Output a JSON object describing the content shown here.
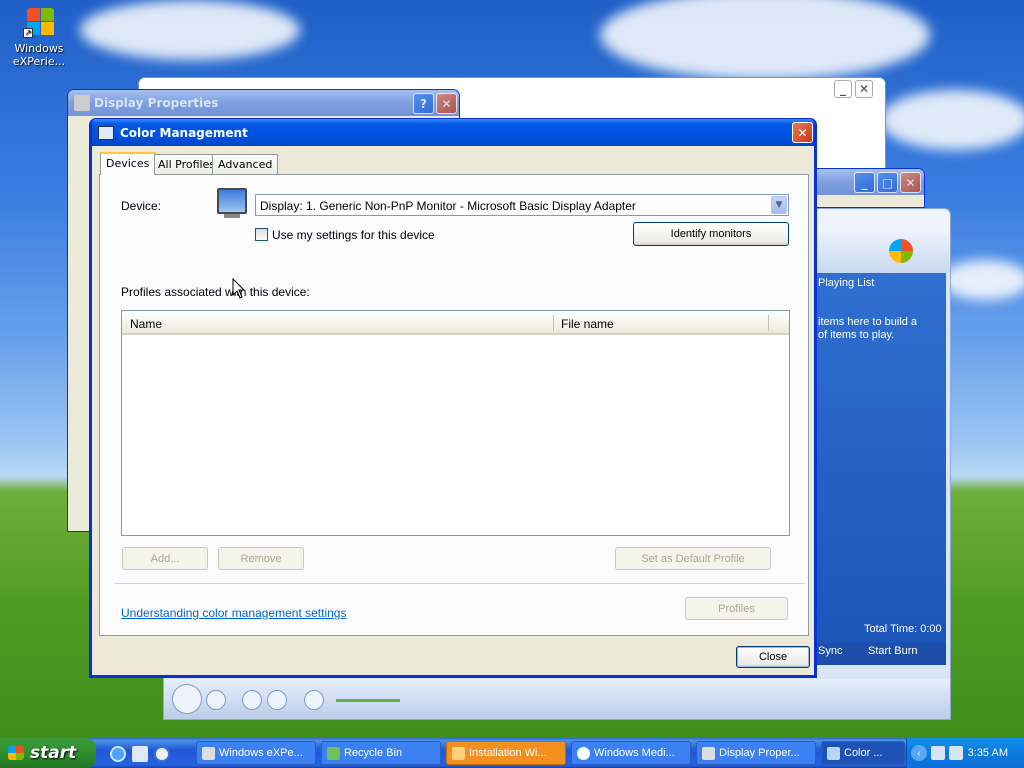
{
  "desktop": {
    "icon_label": "Windows eXPerie..."
  },
  "background_windows": {
    "display_properties_title": "Display Properties",
    "wmp_playing_list": "Playing List",
    "wmp_hint": "items here to build a of items to play.",
    "wmp_total_time": "Total Time: 0:00",
    "wmp_sync": "Sync",
    "wmp_start_burn": "Start Burn"
  },
  "dialog": {
    "title": "Color Management",
    "tabs": [
      {
        "label": "Devices",
        "active": true
      },
      {
        "label": "All Profiles",
        "active": false
      },
      {
        "label": "Advanced",
        "active": false
      }
    ],
    "device_label": "Device:",
    "device_value": "Display: 1. Generic Non-PnP Monitor - Microsoft Basic Display Adapter",
    "use_settings_label": "Use my settings for this device",
    "use_settings_checked": false,
    "identify_button": "Identify monitors",
    "profiles_label": "Profiles associated with this device:",
    "table_columns": [
      "Name",
      "File name"
    ],
    "table_rows": [],
    "add_button": "Add...",
    "remove_button": "Remove",
    "set_default_button": "Set as Default Profile",
    "link_text": "Understanding color management settings",
    "profiles_button": "Profiles",
    "close_button": "Close"
  },
  "taskbar": {
    "start_label": "start",
    "items": [
      {
        "label": "Windows eXPe...",
        "state": "normal"
      },
      {
        "label": "Recycle Bin",
        "state": "normal"
      },
      {
        "label": "Installation Wi...",
        "state": "flash"
      },
      {
        "label": "Windows Medi...",
        "state": "normal"
      },
      {
        "label": "Display Proper...",
        "state": "normal"
      },
      {
        "label": "Color ...",
        "state": "selected"
      }
    ],
    "clock": "3:35 AM"
  },
  "colors": {
    "xp_blue": "#0054e3",
    "link": "#0066cc",
    "close_red": "#c33b12"
  }
}
